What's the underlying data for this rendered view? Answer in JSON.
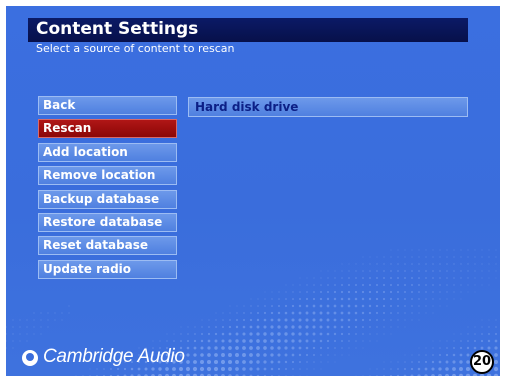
{
  "header": {
    "title": "Content Settings",
    "subtitle": "Select a source of content to rescan"
  },
  "menu": {
    "items": [
      {
        "label": "Back",
        "selected": false
      },
      {
        "label": "Rescan",
        "selected": true
      },
      {
        "label": "Add location",
        "selected": false
      },
      {
        "label": "Remove location",
        "selected": false
      },
      {
        "label": "Backup database",
        "selected": false
      },
      {
        "label": "Restore database",
        "selected": false
      },
      {
        "label": "Reset database",
        "selected": false
      },
      {
        "label": "Update radio",
        "selected": false
      }
    ]
  },
  "content": {
    "items": [
      {
        "label": "Hard disk drive"
      }
    ]
  },
  "branding": {
    "logo_text": "Cambridge Audio",
    "icon": "cambridge-audio-logo-icon"
  },
  "page_number": "20",
  "colors": {
    "background": "#3a6ddc",
    "title_bar": "#07104a",
    "selected_item": "#9e0c0c",
    "menu_item": "#5f8ee6",
    "content_text": "#0c1f86"
  }
}
